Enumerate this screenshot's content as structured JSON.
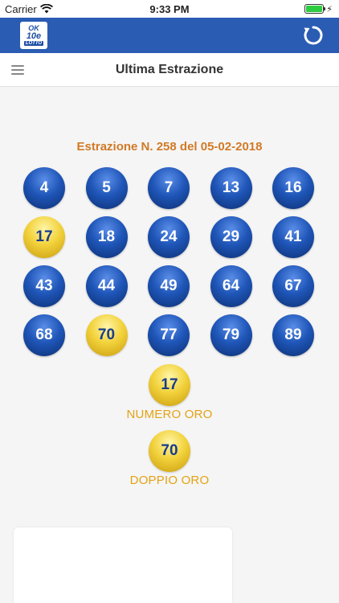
{
  "status_bar": {
    "carrier": "Carrier",
    "time": "9:33 PM",
    "battery_level": 1.0
  },
  "app_header": {
    "logo": {
      "ok": "OK",
      "ten": "10e",
      "lotto": "LOTTO"
    },
    "refresh_icon": "refresh-icon"
  },
  "nav": {
    "title": "Ultima Estrazione",
    "menu_icon": "hamburger-menu-icon"
  },
  "draw": {
    "title": "Estrazione N. 258 del 05-02-2018",
    "numbers": [
      "4",
      "5",
      "7",
      "13",
      "16",
      "17",
      "18",
      "24",
      "29",
      "41",
      "43",
      "44",
      "49",
      "64",
      "67",
      "68",
      "70",
      "77",
      "79",
      "89"
    ],
    "highlighted": [
      "17",
      "70"
    ]
  },
  "numero_oro": {
    "value": "17",
    "label": "NUMERO ORO"
  },
  "doppio_oro": {
    "value": "70",
    "label": "DOPPIO ORO"
  },
  "colors": {
    "header_blue": "#2a5cb3",
    "draw_title": "#d17a26",
    "gold_label": "#e4a215",
    "ball_blue": "#1f56b8",
    "ball_gold": "#f2d23c"
  }
}
